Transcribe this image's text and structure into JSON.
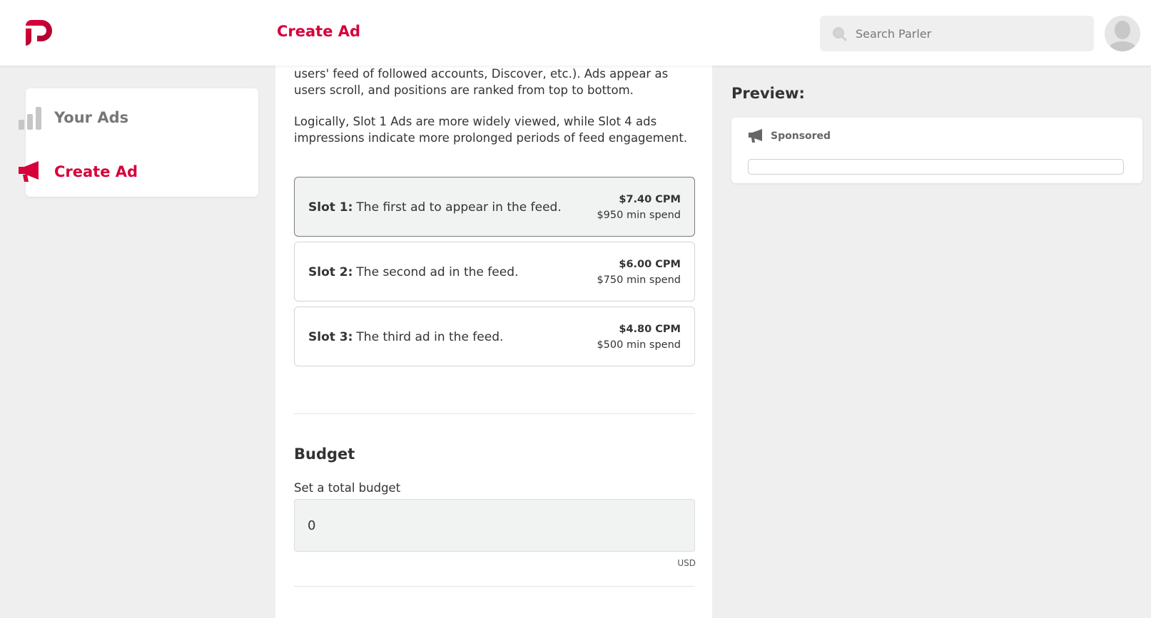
{
  "header": {
    "title": "Create Ad",
    "search_placeholder": "Search Parler"
  },
  "nav": {
    "items": [
      {
        "label": "Your Ads",
        "icon": "bar-chart-icon",
        "active": false
      },
      {
        "label": "Create Ad",
        "icon": "megaphone-icon",
        "active": true
      }
    ]
  },
  "intro": {
    "paragraph1": "users' feed of followed accounts, Discover, etc.). Ads appear as users scroll, and positions are ranked from top to bottom.",
    "paragraph2": "Logically, Slot 1 Ads are more widely viewed, while Slot 4 ads impressions indicate more prolonged periods of feed engagement."
  },
  "slots": [
    {
      "name": "Slot 1:",
      "description": "The first ad to appear in the feed.",
      "cpm": "$7.40 CPM",
      "min_spend": "$950 min spend",
      "selected": true
    },
    {
      "name": "Slot 2:",
      "description": "The second ad in the feed.",
      "cpm": "$6.00 CPM",
      "min_spend": "$750 min spend",
      "selected": false
    },
    {
      "name": "Slot 3:",
      "description": "The third ad in the feed.",
      "cpm": "$4.80 CPM",
      "min_spend": "$500 min spend",
      "selected": false
    }
  ],
  "budget": {
    "title": "Budget",
    "label": "Set a total budget",
    "value": "0",
    "currency": "USD"
  },
  "preview": {
    "title": "Preview:",
    "sponsored_label": "Sponsored"
  },
  "colors": {
    "brand": "#d6003a",
    "muted": "#777777"
  }
}
